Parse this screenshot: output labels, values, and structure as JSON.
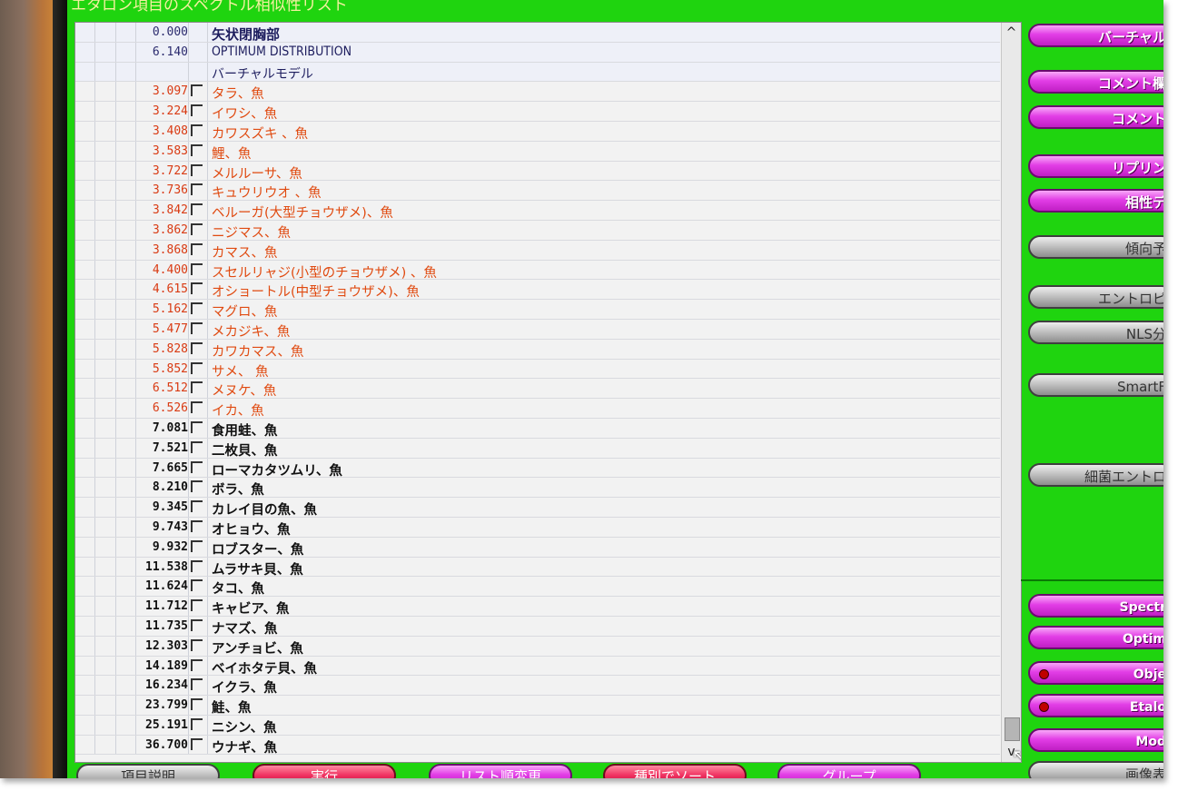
{
  "window_title": "エタロン項目のスペクトル相似性リスト",
  "header_rows": [
    {
      "score": "0.000",
      "name": "矢状閉胸部"
    },
    {
      "score": "6.140",
      "name": "OPTIMUM DISTRIBUTION"
    },
    {
      "score": "",
      "name": "バーチャルモデル"
    }
  ],
  "red_items": [
    {
      "score": "3.097",
      "name": "タラ、魚"
    },
    {
      "score": "3.224",
      "name": "イワシ、魚"
    },
    {
      "score": "3.408",
      "name": "カワスズキ 、魚"
    },
    {
      "score": "3.583",
      "name": "鯉、魚"
    },
    {
      "score": "3.722",
      "name": "メルルーサ、魚"
    },
    {
      "score": "3.736",
      "name": "キュウリウオ 、魚"
    },
    {
      "score": "3.842",
      "name": "ベルーガ(大型チョウザメ)、魚"
    },
    {
      "score": "3.862",
      "name": "ニジマス、魚"
    },
    {
      "score": "3.868",
      "name": "カマス、魚"
    },
    {
      "score": "4.400",
      "name": "スセルリャジ(小型のチョウザメ) 、魚"
    },
    {
      "score": "4.615",
      "name": "オショートル(中型チョウザメ)、魚"
    },
    {
      "score": "5.162",
      "name": "マグロ、魚"
    },
    {
      "score": "5.477",
      "name": "メカジキ、魚"
    },
    {
      "score": "5.828",
      "name": "カワカマス、魚"
    },
    {
      "score": "5.852",
      "name": "サメ、 魚"
    },
    {
      "score": "6.512",
      "name": "メヌケ、魚"
    },
    {
      "score": "6.526",
      "name": "イカ、魚"
    }
  ],
  "black_items": [
    {
      "score": "7.081",
      "name": "食用蛙、魚"
    },
    {
      "score": "7.521",
      "name": "二枚貝、魚"
    },
    {
      "score": "7.665",
      "name": "ローマカタツムリ、魚"
    },
    {
      "score": "8.210",
      "name": "ボラ、魚"
    },
    {
      "score": "9.345",
      "name": "カレイ目の魚、魚"
    },
    {
      "score": "9.743",
      "name": "オヒョウ、魚"
    },
    {
      "score": "9.932",
      "name": "ロブスター、魚"
    },
    {
      "score": "11.538",
      "name": "ムラサキ貝、魚"
    },
    {
      "score": "11.624",
      "name": "タコ、魚"
    },
    {
      "score": "11.712",
      "name": "キャビア、魚"
    },
    {
      "score": "11.735",
      "name": "ナマズ、魚"
    },
    {
      "score": "12.303",
      "name": "アンチョビ、魚"
    },
    {
      "score": "14.189",
      "name": "ベイホタテ貝、魚"
    },
    {
      "score": "16.234",
      "name": "イクラ、魚"
    },
    {
      "score": "23.799",
      "name": "鮭、魚"
    },
    {
      "score": "25.191",
      "name": "ニシン、魚"
    },
    {
      "score": "36.700",
      "name": "ウナギ、魚"
    }
  ],
  "side_buttons": {
    "virtual": "バーチャル",
    "comment_column": "コメント欄",
    "comment": "コメント",
    "replin": "リプリン",
    "compat": "相性デ",
    "tendency": "傾向予",
    "entropy": "エントロピ",
    "nls": "NLS分",
    "smartf": "SmartF",
    "bacteria_entropy": "細菌エントロ",
    "spectr": "Spectr",
    "optim": "Optim",
    "obje": "Obje",
    "etalo": "Etalo",
    "mod": "Mod",
    "image": "画像表"
  },
  "bottom_buttons": {
    "b1": "項目説明",
    "b2": "実行",
    "b3": "リスト順変更",
    "b4": "種別でソート",
    "b5": "グループ"
  },
  "scrollbar": {
    "up_glyph": "^",
    "down_glyph": "v"
  },
  "colors": {
    "screen_bg": "#1fd40f",
    "accent_magenta": "#e23ee6",
    "red_text": "#e04a10",
    "list_bg": "#f2f2f2"
  }
}
